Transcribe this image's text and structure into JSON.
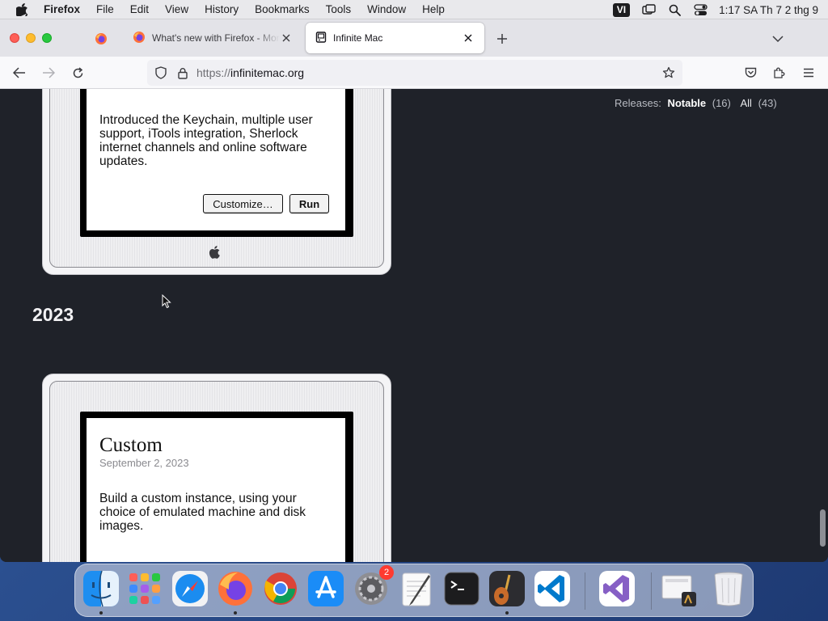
{
  "menubar": {
    "app_name": "Firefox",
    "items": [
      "File",
      "Edit",
      "View",
      "History",
      "Bookmarks",
      "Tools",
      "Window",
      "Help"
    ],
    "input_source": "VI",
    "clock": "1:17 SA Th 7 2 thg 9"
  },
  "browser": {
    "tabs": [
      {
        "title": "What's new with Firefox - More",
        "active": false
      },
      {
        "title": "Infinite Mac",
        "active": true
      }
    ],
    "url_scheme": "https://",
    "url_host": "infinitemac.org"
  },
  "page": {
    "releases": {
      "label": "Releases:",
      "notable_label": "Notable",
      "notable_count": "(16)",
      "all_label": "All",
      "all_count": "(43)"
    },
    "cards_above": [
      {
        "description": "Introduced the Keychain, multiple user support, iTools integration, Sherlock internet channels and online software updates.",
        "customize_label": "Customize…",
        "run_label": "Run"
      }
    ],
    "year": "2023",
    "cards_2023": [
      {
        "title": "Custom",
        "date": "September 2, 2023",
        "description": "Build a custom instance, using your choice of emulated machine and disk images."
      }
    ]
  },
  "dock": {
    "apps": [
      "Finder",
      "Launchpad",
      "Safari",
      "Firefox",
      "Google Chrome",
      "App Store",
      "System Preferences",
      "TextEdit",
      "Terminal",
      "Instruments",
      "Visual Studio Code",
      "Visual Studio",
      "Downloads",
      "Trash"
    ],
    "system_prefs_badge": "2"
  },
  "colors": {
    "page_background": "#1f2229",
    "accent_close": "#fe5f57",
    "accent_minimize": "#febc2e",
    "accent_zoom": "#28c840"
  }
}
